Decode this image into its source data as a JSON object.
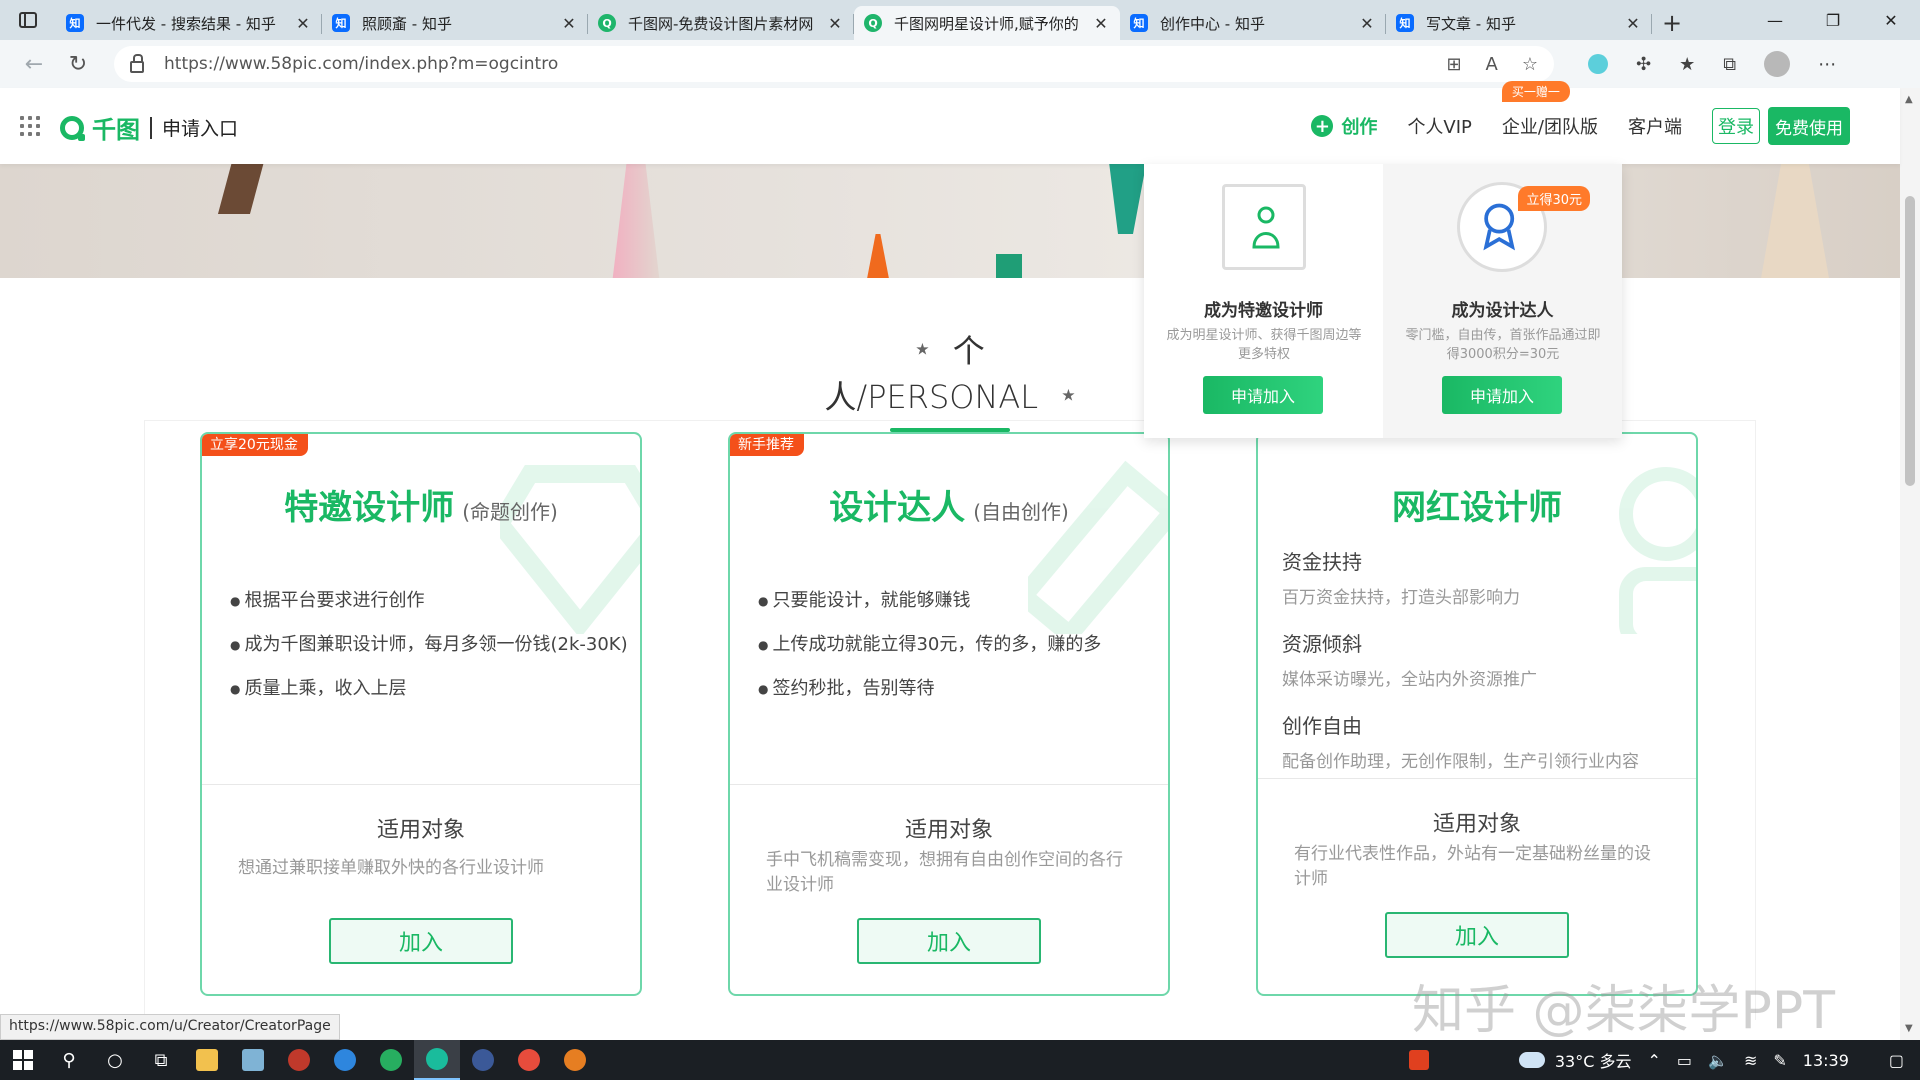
{
  "browser": {
    "tabs": [
      {
        "label": "一件代发 - 搜索结果 - 知乎",
        "favicon": "zhihu-icon",
        "active": false
      },
      {
        "label": "照顾齑 - 知乎",
        "favicon": "zhihu-icon",
        "active": false
      },
      {
        "label": "千图网-免费设计图片素材网",
        "favicon": "qiantu-icon",
        "active": false
      },
      {
        "label": "千图网明星设计师,赋予你的",
        "favicon": "qiantu-icon",
        "active": true
      },
      {
        "label": "创作中心 - 知乎",
        "favicon": "zhihu-icon",
        "active": false
      },
      {
        "label": "写文章 - 知乎",
        "favicon": "zhihu-icon",
        "active": false
      }
    ],
    "url": "https://www.58pic.com/index.php?m=ogcintro",
    "status_url": "https://www.58pic.com/u/Creator/CreatorPage"
  },
  "header": {
    "logo_text": "千图",
    "logo_sub": "申请入口",
    "create_label": "创作",
    "vip_label": "个人VIP",
    "team_label": "企业/团队版",
    "team_badge": "买一赠一",
    "client_label": "客户端",
    "login_label": "登录",
    "free_label": "免费使用"
  },
  "section": {
    "title": "个人/PERSONAL"
  },
  "cards": [
    {
      "ribbon": "立享20元现金",
      "title": "特邀设计师",
      "subtitle": "(命题创作)",
      "bullets": [
        "根据平台要求进行创作",
        "成为千图兼职设计师，每月多领一份钱(2k-30K)",
        "质量上乘，收入上层"
      ],
      "target_title": "适用对象",
      "target_desc": "想通过兼职接单赚取外快的各行业设计师",
      "join_label": "加入"
    },
    {
      "ribbon": "新手推荐",
      "title": "设计达人",
      "subtitle": "(自由创作)",
      "bullets": [
        "只要能设计，就能够赚钱",
        "上传成功就能立得30元，传的多，赚的多",
        "签约秒批，告别等待"
      ],
      "target_title": "适用对象",
      "target_desc": "手中飞机稿需变现，想拥有自由创作空间的各行业设计师",
      "join_label": "加入"
    },
    {
      "title": "网红设计师",
      "features": [
        {
          "heading": "资金扶持",
          "desc": "百万资金扶持，打造头部影响力"
        },
        {
          "heading": "资源倾斜",
          "desc": "媒体采访曝光，全站内外资源推广"
        },
        {
          "heading": "创作自由",
          "desc": "配备创作助理，无创作限制，生产引领行业内容"
        }
      ],
      "target_title": "适用对象",
      "target_desc": "有行业代表性作品，外站有一定基础粉丝量的设计师",
      "join_label": "加入"
    }
  ],
  "dropdown": {
    "items": [
      {
        "title": "成为特邀设计师",
        "desc": "成为明星设计师、获得千图周边等更多特权",
        "button": "申请加入"
      },
      {
        "title": "成为设计达人",
        "tag": "立得30元",
        "desc": "零门槛，自由传，首张作品通过即得3000积分=30元",
        "button": "申请加入"
      }
    ]
  },
  "watermark": "知乎 @柒柒学PPT",
  "taskbar": {
    "weather": "33°C 多云",
    "time": "13:39"
  },
  "colors": {
    "brand_green": "#1ab864",
    "orange_badge": "#ff7a2a",
    "ribbon_red": "#f4501a"
  }
}
